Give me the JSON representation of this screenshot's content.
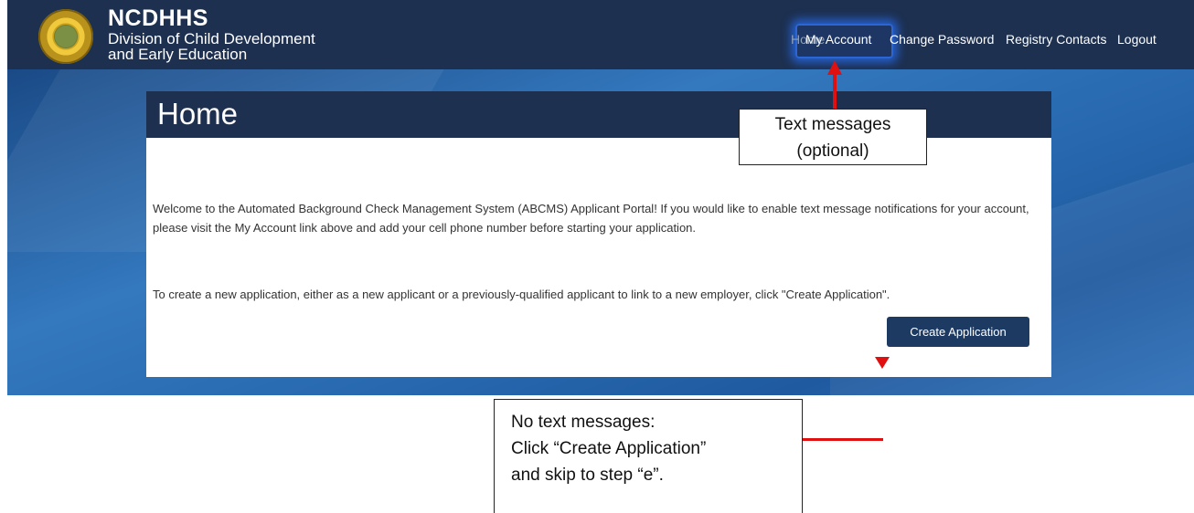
{
  "header": {
    "title": "NCDHHS",
    "subtitle": "Division of Child Development\nand Early Education",
    "logo": "nc-state-seal"
  },
  "nav": {
    "home": "Home",
    "my_account": "My Account",
    "change_password": "Change Password",
    "registry_contacts": "Registry Contacts",
    "logout": "Logout"
  },
  "page": {
    "title": "Home",
    "welcome": "Welcome to the Automated Background Check Management System (ABCMS) Applicant Portal! If you would like to enable text message notifications for your account, please visit the My Account link above and add your cell phone number before starting your application.",
    "create_instructions": "To create a new application, either as a new applicant or a previously-qualified applicant to link to a new employer, click \"Create Application\".",
    "create_button": "Create Application"
  },
  "annotations": {
    "top_callout": {
      "line1": "Text messages",
      "line2": "(optional)"
    },
    "bottom_callout": {
      "line1": "No text messages:",
      "line2": "Click “Create Application”",
      "line3": "and skip to step “e”."
    },
    "highlight_color": "#2b66d6",
    "arrow_color": "#e01010"
  },
  "colors": {
    "navy": "#1d3050",
    "button": "#1d3a63",
    "hero_blue": "#3478be"
  }
}
